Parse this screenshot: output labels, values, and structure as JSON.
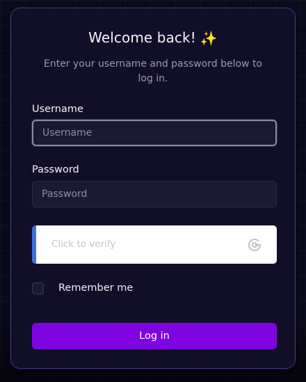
{
  "login": {
    "title": "Welcome back!",
    "title_icon": "sparkles-icon",
    "subtitle": "Enter your username and password below to log in.",
    "username_label": "Username",
    "username_placeholder": "Username",
    "username_value": "",
    "password_label": "Password",
    "password_placeholder": "Password",
    "password_value": "",
    "captcha_text": "Click to verify",
    "captcha_icon": "refresh-g-icon",
    "remember_label": "Remember me",
    "remember_checked": false,
    "login_button": "Log in"
  },
  "colors": {
    "accent": "#7e04e0",
    "captcha_bar": "#3f6fe0",
    "card_border": "#3e3a7a",
    "background": "#0c0b1c"
  }
}
